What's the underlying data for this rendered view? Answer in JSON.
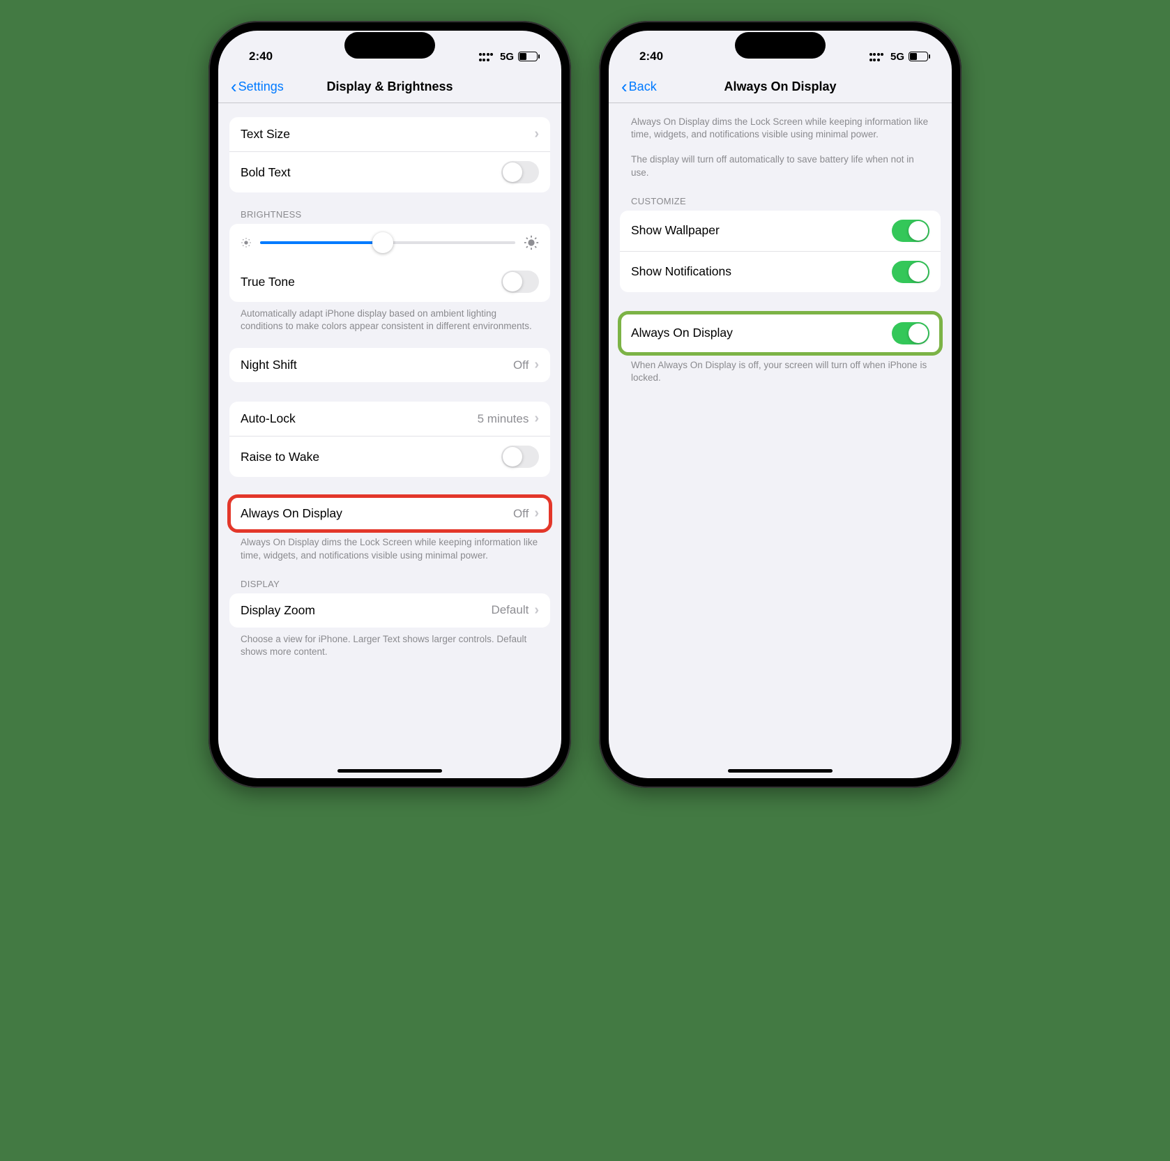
{
  "status": {
    "time": "2:40",
    "network": "5G"
  },
  "left": {
    "back_label": "Settings",
    "title": "Display & Brightness",
    "text_size": "Text Size",
    "bold_text": "Bold Text",
    "brightness_header": "BRIGHTNESS",
    "true_tone": "True Tone",
    "true_tone_footer": "Automatically adapt iPhone display based on ambient lighting conditions to make colors appear consistent in different environments.",
    "night_shift": "Night Shift",
    "night_shift_value": "Off",
    "auto_lock": "Auto-Lock",
    "auto_lock_value": "5 minutes",
    "raise_to_wake": "Raise to Wake",
    "aod": "Always On Display",
    "aod_value": "Off",
    "aod_footer": "Always On Display dims the Lock Screen while keeping information like time, widgets, and notifications visible using minimal power.",
    "display_header": "DISPLAY",
    "display_zoom": "Display Zoom",
    "display_zoom_value": "Default",
    "display_zoom_footer": "Choose a view for iPhone. Larger Text shows larger controls. Default shows more content."
  },
  "right": {
    "back_label": "Back",
    "title": "Always On Display",
    "intro1": "Always On Display dims the Lock Screen while keeping information like time, widgets, and notifications visible using minimal power.",
    "intro2": "The display will turn off automatically to save battery life when not in use.",
    "customize_header": "CUSTOMIZE",
    "show_wallpaper": "Show Wallpaper",
    "show_notifications": "Show Notifications",
    "aod_toggle": "Always On Display",
    "aod_footer": "When Always On Display is off, your screen will turn off when iPhone is locked."
  }
}
